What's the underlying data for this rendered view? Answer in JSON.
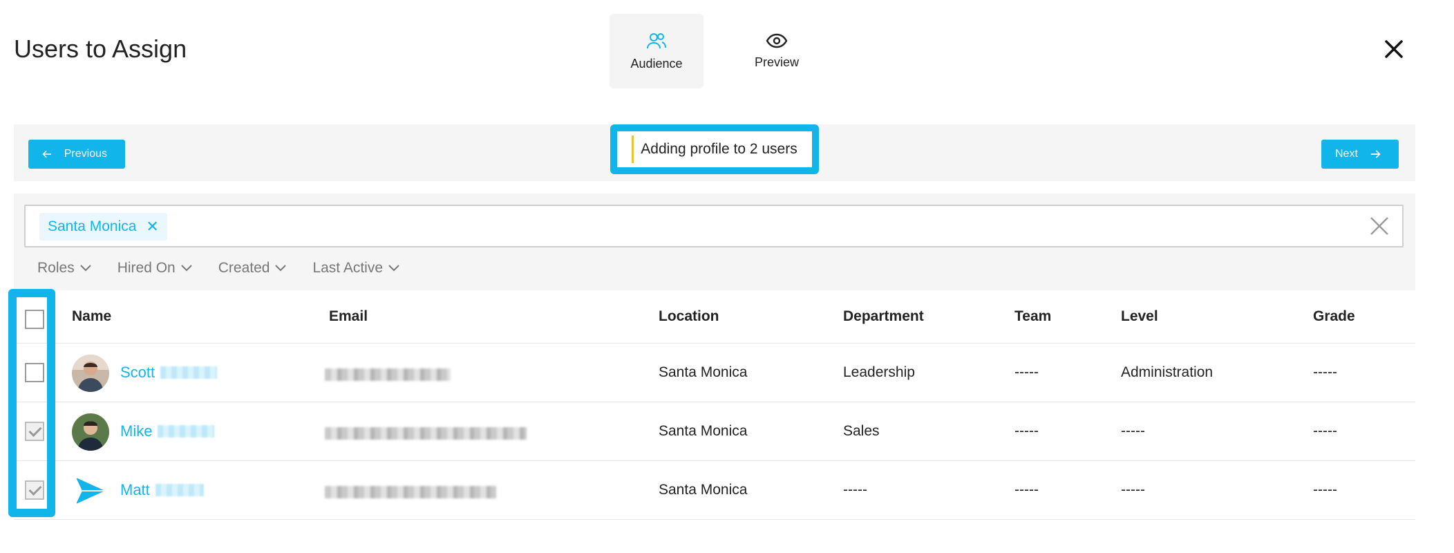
{
  "header": {
    "title": "Users to Assign",
    "tabs": [
      {
        "label": "Audience",
        "icon": "users-icon",
        "active": true
      },
      {
        "label": "Preview",
        "icon": "eye-icon",
        "active": false
      }
    ],
    "close_icon": "close-icon"
  },
  "nav": {
    "previous_label": "Previous",
    "next_label": "Next",
    "status": "Adding profile to 2 users"
  },
  "filters": {
    "active_chip": "Santa Monica",
    "dropdowns": [
      "Roles",
      "Hired On",
      "Created",
      "Last Active"
    ]
  },
  "table": {
    "columns": [
      "Name",
      "Email",
      "Location",
      "Department",
      "Team",
      "Level",
      "Grade"
    ],
    "rows": [
      {
        "name": "Scott",
        "location": "Santa Monica",
        "department": "Leadership",
        "team": "-----",
        "level": "Administration",
        "grade": "-----",
        "checked": false
      },
      {
        "name": "Mike",
        "location": "Santa Monica",
        "department": "Sales",
        "team": "-----",
        "level": "-----",
        "grade": "-----",
        "checked": true
      },
      {
        "name": "Matt",
        "location": "Santa Monica",
        "department": "-----",
        "team": "-----",
        "level": "-----",
        "grade": "-----",
        "checked": true
      }
    ]
  },
  "colors": {
    "accent": "#12b5ea",
    "panel": "#f5f5f5"
  }
}
